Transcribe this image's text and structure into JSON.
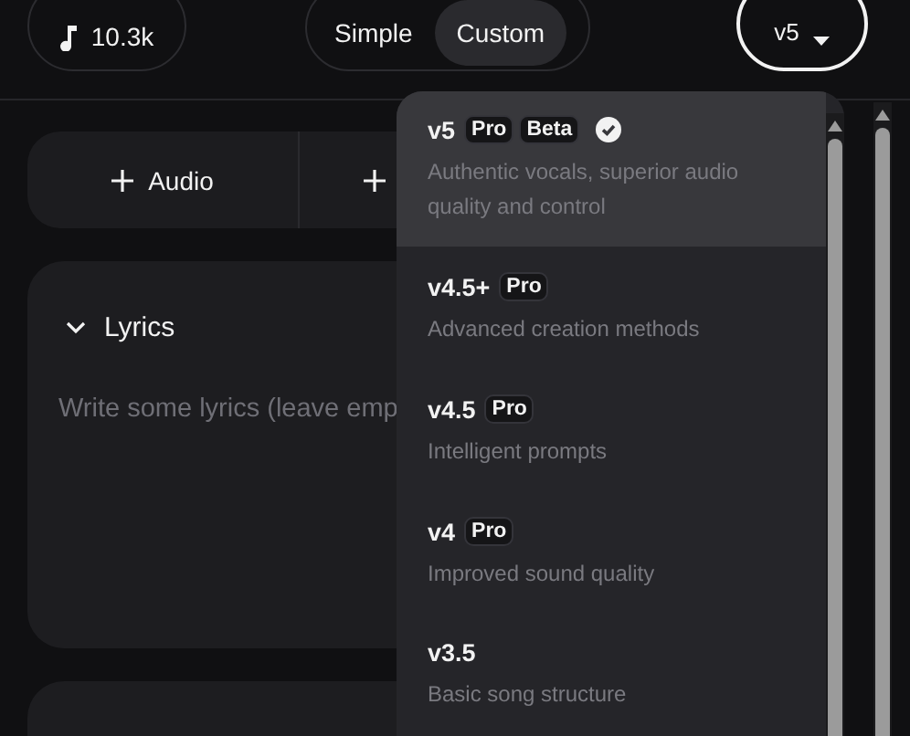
{
  "header": {
    "credits": "10.3k",
    "mode_tabs": [
      {
        "label": "Simple",
        "selected": false
      },
      {
        "label": "Custom",
        "selected": true
      }
    ],
    "version_button": "v5"
  },
  "add_buttons": [
    {
      "label": "Audio"
    },
    {
      "kind": "partial"
    }
  ],
  "lyrics": {
    "title": "Lyrics",
    "expanded": true,
    "placeholder": "Write some lyrics (leave emp"
  },
  "version_menu": [
    {
      "name": "v5",
      "badges": [
        "Pro",
        "Beta"
      ],
      "description": "Authentic vocals, superior audio quality and control",
      "selected": true
    },
    {
      "name": "v4.5+",
      "badges": [
        "Pro"
      ],
      "description": "Advanced creation methods",
      "selected": false
    },
    {
      "name": "v4.5",
      "badges": [
        "Pro"
      ],
      "description": "Intelligent prompts",
      "selected": false
    },
    {
      "name": "v4",
      "badges": [
        "Pro"
      ],
      "description": "Improved sound quality",
      "selected": false
    },
    {
      "name": "v3.5",
      "description": "Basic song structure",
      "selected": false
    }
  ]
}
